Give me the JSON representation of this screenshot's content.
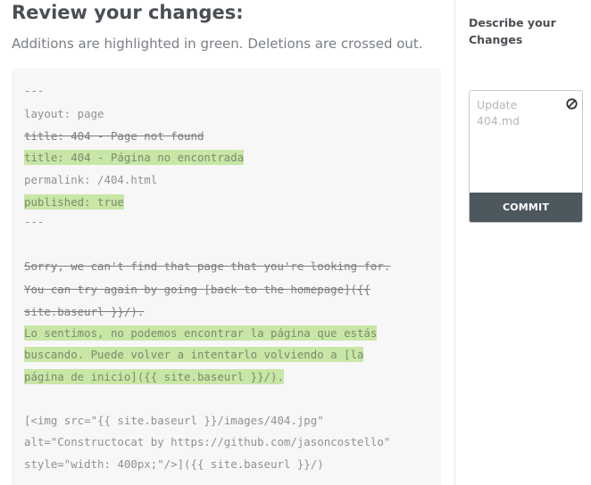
{
  "header": {
    "title": "Review your changes:",
    "subtitle": "Additions are highlighted in green. Deletions are crossed out."
  },
  "diff": {
    "lines": [
      {
        "text": "---",
        "type": "context"
      },
      {
        "text": "layout: page",
        "type": "context"
      },
      {
        "text": "title: 404 - Page not found",
        "type": "deleted"
      },
      {
        "text": "title: 404 - Página no encontrada",
        "type": "added"
      },
      {
        "text": "permalink: /404.html",
        "type": "context"
      },
      {
        "text": "published: true",
        "type": "added"
      },
      {
        "text": "---",
        "type": "context"
      },
      {
        "text": "Sorry, we can't find that page that you're looking for.",
        "type": "deleted"
      },
      {
        "text": "You can try again by going [back to the homepage]({{",
        "type": "deleted"
      },
      {
        "text": "site.baseurl }}/).",
        "type": "deleted"
      },
      {
        "text": "Lo sentimos, no podemos encontrar la página que estás",
        "type": "added"
      },
      {
        "text": "buscando. Puede volver a intentarlo volviendo a [la",
        "type": "added"
      },
      {
        "text": "página de inicio]({{ site.baseurl }}/).",
        "type": "added"
      },
      {
        "text": "[<img src=\"{{ site.baseurl }}/images/404.jpg\"",
        "type": "context"
      },
      {
        "text": "alt=\"Constructocat by https://github.com/jasoncostello\"",
        "type": "context"
      },
      {
        "text": "style=\"width: 400px;\"/>]({{ site.baseurl }}/)",
        "type": "context"
      }
    ]
  },
  "sidebar": {
    "title": "Describe your Changes",
    "commit_placeholder": "Update 404.md",
    "commit_button": "COMMIT",
    "clear_icon": "ban-icon"
  },
  "colors": {
    "addition_highlight": "#c8e7a6",
    "commit_button_bg": "#4d575e",
    "code_background": "#f7f7f7"
  }
}
